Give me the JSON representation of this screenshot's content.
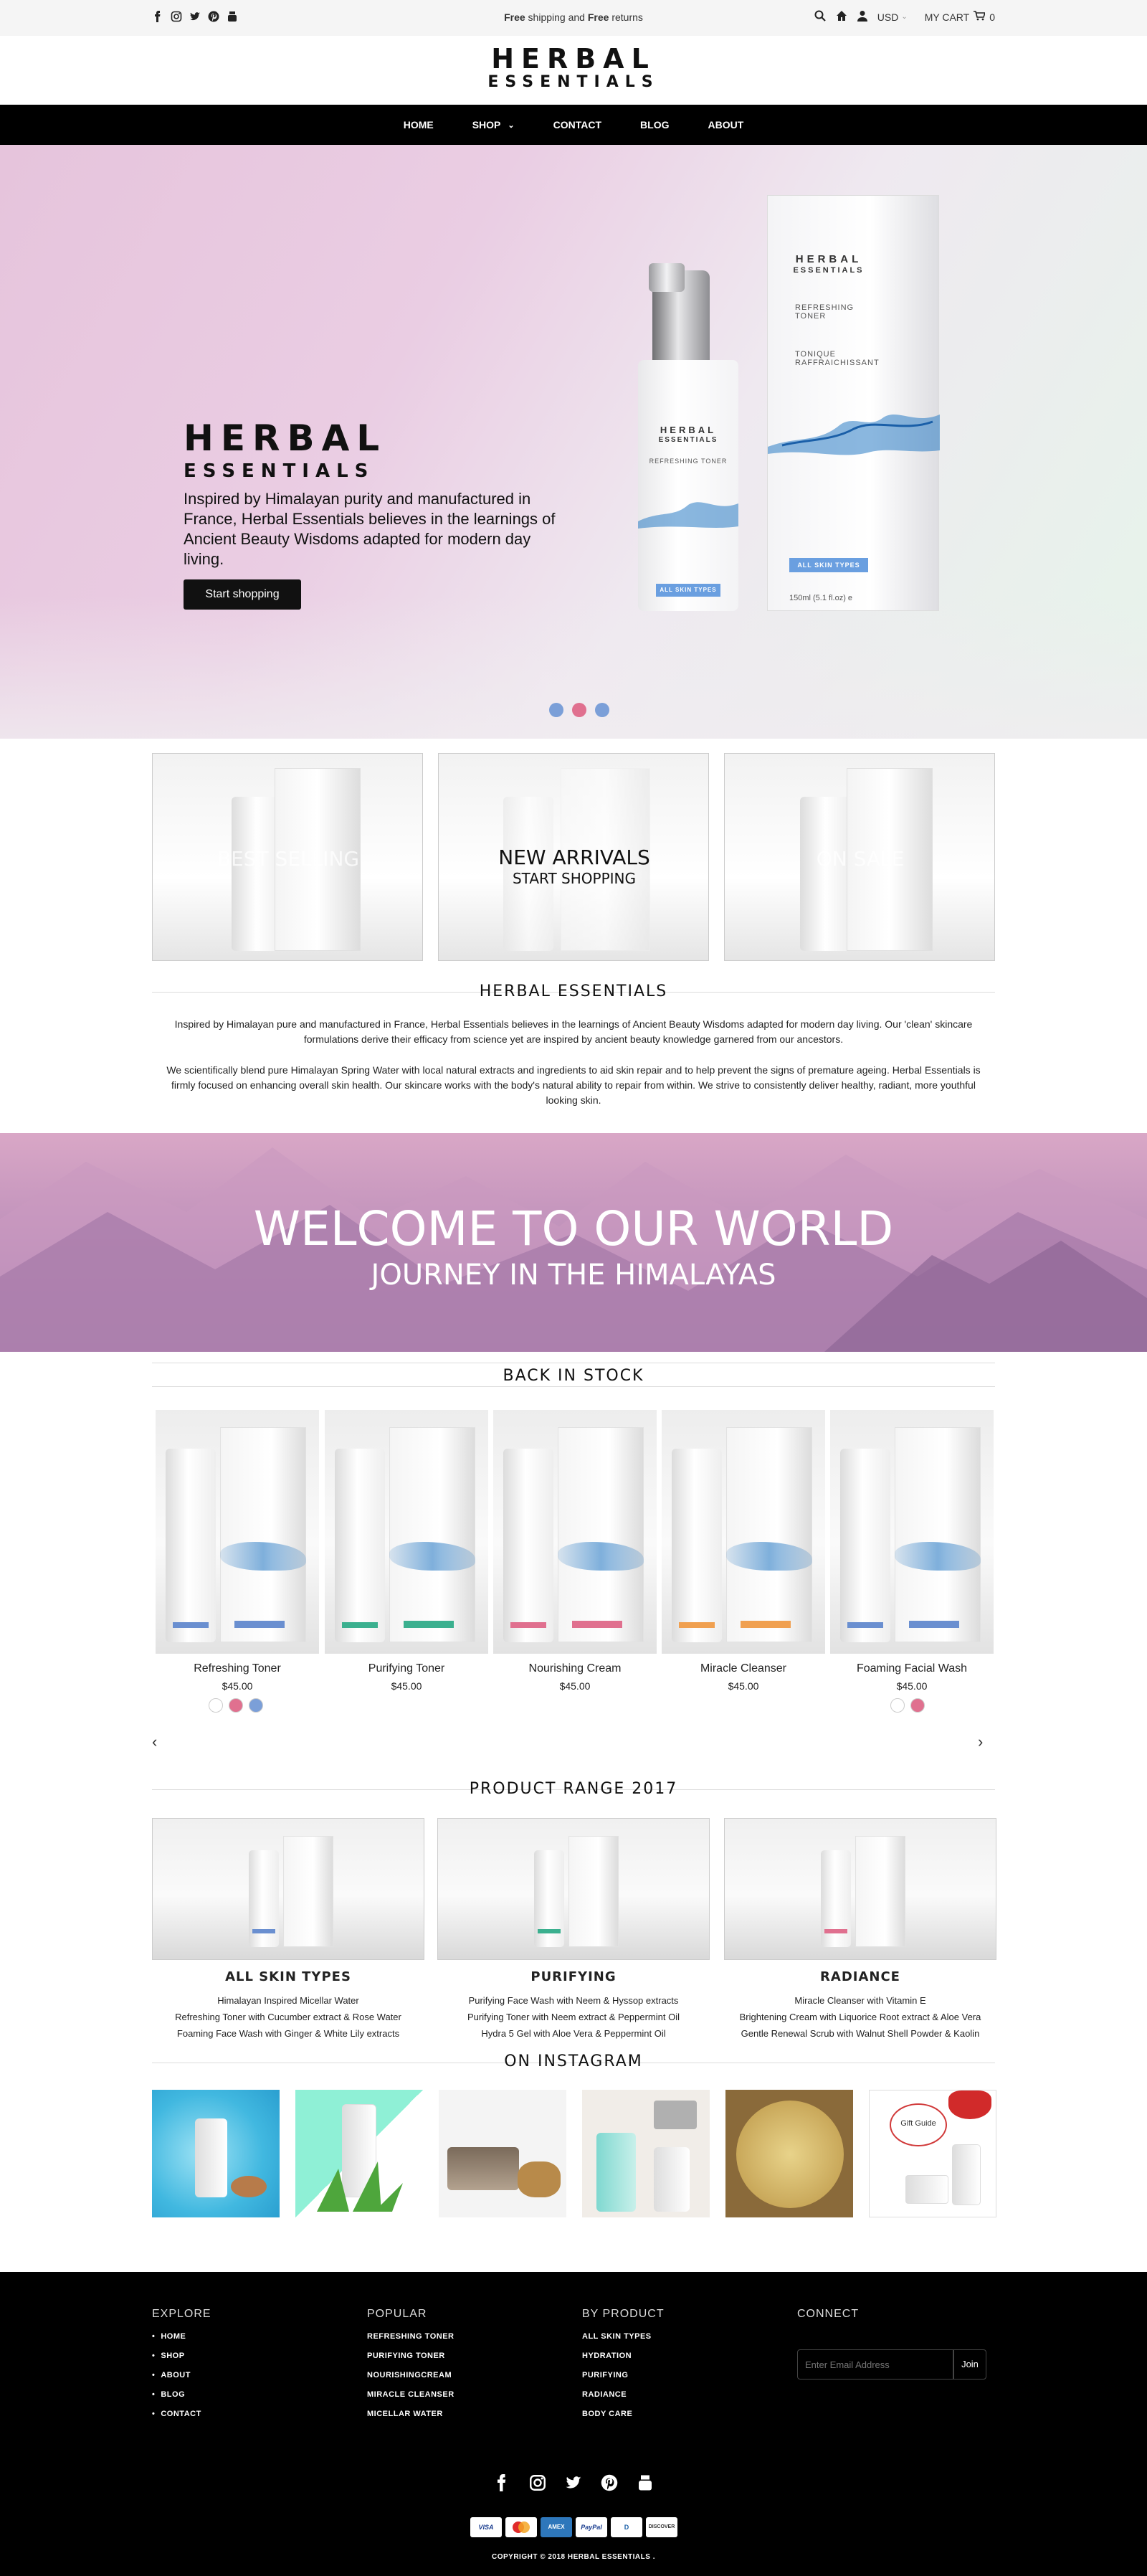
{
  "topbar": {
    "promo_free1": "Free",
    "promo_mid": " shipping and ",
    "promo_free2": "Free",
    "promo_end": " returns",
    "currency": "USD",
    "cart_label": "MY CART",
    "cart_count": "0",
    "social_icons": [
      "facebook-icon",
      "instagram-icon",
      "twitter-icon",
      "pinterest-icon",
      "youtube-icon"
    ]
  },
  "logo": {
    "line1": "HERBAL",
    "line2": "ESSENTIALS"
  },
  "nav": {
    "items": [
      "HOME",
      "SHOP",
      "CONTACT",
      "BLOG",
      "ABOUT"
    ]
  },
  "hero": {
    "title1": "HERBAL",
    "title2": "ESSENTIALS",
    "text": "Inspired by Himalayan purity and manufactured in France,  Herbal Essentials believes in the learnings of Ancient Beauty Wisdoms adapted for modern day living.",
    "button": "Start shopping",
    "bottle_brand1": "HERBAL",
    "bottle_brand2": "ESSENTIALS",
    "bottle_name": "REFRESHING TONER",
    "box_name": "REFRESHING TONER",
    "box_fr": "TONIQUE RAFFRAICHISSANT",
    "bottle_tag": "ALL SKIN TYPES",
    "box_tag": "ALL SKIN TYPES",
    "volume": "150ml (5.1 fl.oz) e",
    "dot_colors": [
      "#7b9fd8",
      "#e0708f",
      "#7b9fd8"
    ],
    "active_dot": 2
  },
  "tiles": [
    {
      "label": "BEST SELLING",
      "sub": ""
    },
    {
      "label": "NEW ARRIVALS",
      "sub": "START SHOPPING"
    },
    {
      "label": "ON SALE",
      "sub": ""
    }
  ],
  "about": {
    "title": "HERBAL ESSENTIALS",
    "p1": "Inspired by Himalayan pure and manufactured in France, Herbal Essentials believes in the learnings of Ancient Beauty Wisdoms adapted for modern day living. Our 'clean' skincare formulations derive their efficacy from science yet are inspired by ancient beauty knowledge garnered from our ancestors.",
    "p2": "We scientifically blend pure Himalayan Spring Water with local natural extracts and ingredients to aid skin repair and to help prevent the signs of premature ageing. Herbal Essentials is firmly focused on enhancing overall skin health. Our skincare works with the body's natural ability to repair from within. We strive to consistently deliver healthy, radiant, more youthful looking skin."
  },
  "banner": {
    "title": "WELCOME TO OUR WORLD",
    "subtitle": "JOURNEY IN THE HIMALAYAS"
  },
  "back_in_stock": {
    "title": "BACK IN STOCK",
    "products": [
      {
        "name": "Refreshing Toner",
        "price": "$45.00",
        "swatches": [
          "#ffffff",
          "#e0708f",
          "#7b9fd8"
        ],
        "accent": "#6a8fd0"
      },
      {
        "name": "Purifying Toner",
        "price": "$45.00",
        "swatches": [],
        "accent": "#3bb08f"
      },
      {
        "name": "Nourishing Cream",
        "price": "$45.00",
        "swatches": [],
        "accent": "#e0708f"
      },
      {
        "name": "Miracle Cleanser",
        "price": "$45.00",
        "swatches": [],
        "accent": "#f0a050"
      },
      {
        "name": "Foaming Facial Wash",
        "price": "$45.00",
        "swatches": [
          "#ffffff",
          "#e0708f"
        ],
        "accent": "#6a8fd0"
      }
    ]
  },
  "range": {
    "title": "PRODUCT RANGE 2017",
    "items": [
      {
        "title": "ALL SKIN TYPES",
        "lines": [
          "Himalayan Inspired  Micellar Water",
          "Refreshing Toner  with Cucumber extract  & Rose Water",
          "Foaming Face Wash  with Ginger & White Lily extracts"
        ]
      },
      {
        "title": "PURIFYING",
        "lines": [
          "Purifying Face Wash with Neem & Hyssop extracts",
          "Purifying Toner with Neem extract & Peppermint Oil",
          "Hydra 5 Gel   with Aloe Vera  & Peppermint Oil"
        ]
      },
      {
        "title": "RADIANCE",
        "lines": [
          "Miracle Cleanser with Vitamin E",
          "Brightening Cream with Liquorice Root extract & Aloe Vera",
          "Gentle Renewal Scrub with Walnut Shell Powder & Kaolin"
        ]
      }
    ]
  },
  "instagram": {
    "title": "ON INSTAGRAM",
    "gift_label": "Gift Guide"
  },
  "footer": {
    "explore": {
      "title": "EXPLORE",
      "links": [
        "HOME",
        "SHOP",
        "ABOUT",
        "BLOG",
        "CONTACT"
      ]
    },
    "popular": {
      "title": "POPULAR",
      "links": [
        "REFRESHING TONER",
        "PURIFYING TONER",
        "NOURISHINGCREAM",
        "MIRACLE CLEANSER",
        "MICELLAR WATER"
      ]
    },
    "by_product": {
      "title": "BY PRODUCT",
      "links": [
        "ALL SKIN TYPES",
        "HYDRATION",
        "PURIFYING",
        "RADIANCE",
        "BODY CARE"
      ]
    },
    "connect": {
      "title": "CONNECT",
      "email_placeholder": "Enter Email Address",
      "join": "Join"
    },
    "social_icons": [
      "facebook-icon",
      "instagram-icon",
      "twitter-icon",
      "pinterest-icon",
      "youtube-icon"
    ],
    "payments": [
      "VISA",
      "MC",
      "AMEX",
      "PayPal",
      "D",
      "DISCOVER"
    ],
    "copyright": "COPYRIGHT © 2018  HERBAL ESSENTIALS ."
  }
}
